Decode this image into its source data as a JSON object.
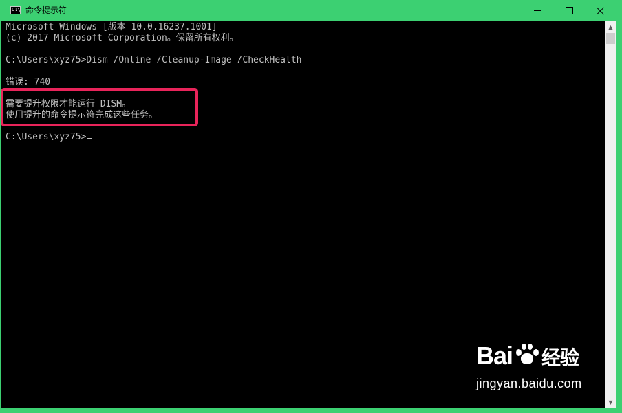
{
  "window": {
    "title": "命令提示符",
    "icon_text": "C:\\"
  },
  "console": {
    "lines": [
      "Microsoft Windows [版本 10.0.16237.1001]",
      "(c) 2017 Microsoft Corporation。保留所有权利。",
      "",
      "C:\\Users\\xyz75>Dism /Online /Cleanup-Image /CheckHealth",
      "",
      "错误: 740",
      "",
      "需要提升权限才能运行 DISM。",
      "使用提升的命令提示符完成这些任务。",
      "",
      "C:\\Users\\xyz75>"
    ]
  },
  "watermark": {
    "logo_left": "Bai",
    "logo_right": "经验",
    "url": "jingyan.baidu.com"
  },
  "colors": {
    "titlebar": "#3cd072",
    "console_bg": "#000000",
    "console_text": "#c0c0c0",
    "highlight": "#e8245a"
  }
}
